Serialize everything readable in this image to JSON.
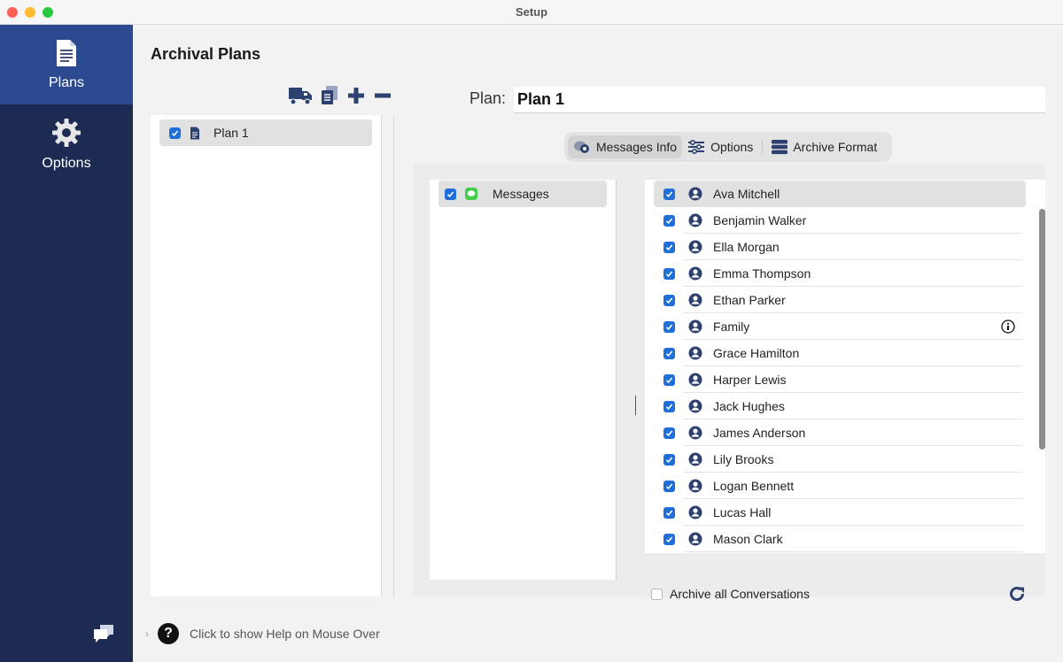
{
  "window": {
    "title": "Setup"
  },
  "sidebar": {
    "items": [
      {
        "label": "Plans",
        "icon": "document-icon",
        "active": true
      },
      {
        "label": "Options",
        "icon": "gear-icon",
        "active": false
      }
    ],
    "footer_icon": "chat-bubbles-icon"
  },
  "header": {
    "title": "Archival Plans"
  },
  "plans_toolbar": {
    "icons": [
      "truck-icon",
      "copy-icon",
      "plus-icon",
      "minus-icon"
    ]
  },
  "plans_list": [
    {
      "label": "Plan 1",
      "checked": true,
      "icon": "document-icon"
    }
  ],
  "plan": {
    "label": "Plan:",
    "value": "Plan 1"
  },
  "tabs": [
    {
      "label": "Messages Info",
      "icon": "messages-info-icon",
      "active": true
    },
    {
      "label": "Options",
      "icon": "sliders-icon",
      "active": false
    },
    {
      "label": "Archive Format",
      "icon": "database-icon",
      "active": false
    }
  ],
  "sources": [
    {
      "label": "Messages",
      "checked": true,
      "icon": "messages-app-icon"
    }
  ],
  "contacts": [
    {
      "name": "Ava Mitchell",
      "checked": true
    },
    {
      "name": "Benjamin Walker",
      "checked": true
    },
    {
      "name": "Ella Morgan",
      "checked": true
    },
    {
      "name": "Emma Thompson",
      "checked": true
    },
    {
      "name": "Ethan Parker",
      "checked": true
    },
    {
      "name": "Family",
      "checked": true
    },
    {
      "name": "Grace Hamilton",
      "checked": true
    },
    {
      "name": "Harper Lewis",
      "checked": true
    },
    {
      "name": "Jack Hughes",
      "checked": true
    },
    {
      "name": "James Anderson",
      "checked": true
    },
    {
      "name": "Lily Brooks",
      "checked": true
    },
    {
      "name": "Logan Bennett",
      "checked": true
    },
    {
      "name": "Lucas Hall",
      "checked": true
    },
    {
      "name": "Mason Clark",
      "checked": true
    }
  ],
  "archive_all": {
    "label": "Archive all Conversations",
    "checked": false
  },
  "help": {
    "text": "Click to show Help on Mouse Over"
  },
  "colors": {
    "sidebar": "#1d2a52",
    "sidebar_active": "#2c4a8f",
    "accent": "#1e6fd9",
    "icon_navy": "#2d4170"
  }
}
